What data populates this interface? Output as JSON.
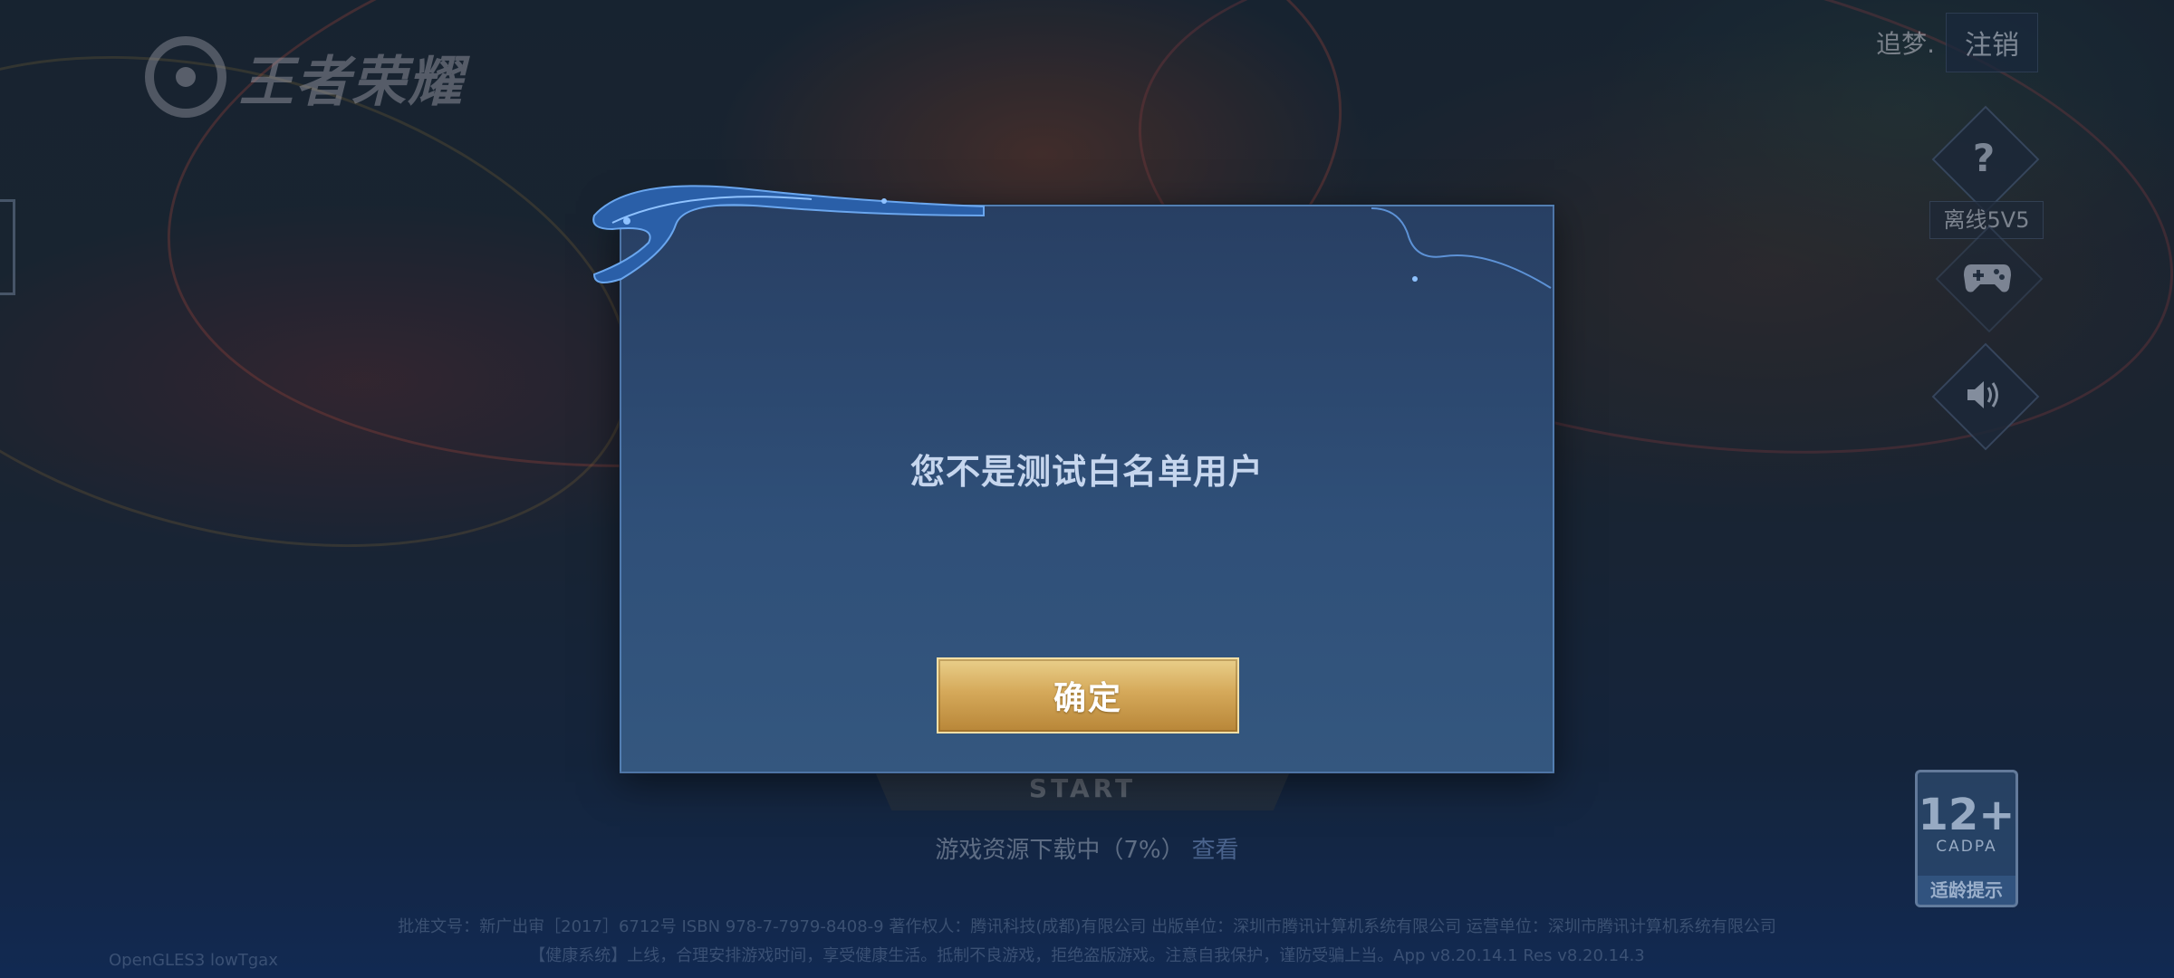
{
  "app": {
    "logo_text": "王者荣耀"
  },
  "account": {
    "name": "追梦.",
    "logout_label": "注销"
  },
  "side_buttons": {
    "help_icon": "question-icon",
    "offline_label": "离线5V5",
    "gamepad_icon": "gamepad-icon",
    "sound_icon": "speaker-icon"
  },
  "start_button": {
    "label": "START"
  },
  "download": {
    "status": "游戏资源下载中（7%）",
    "progress_percent": 7,
    "view_label": "查看"
  },
  "footer": {
    "line1": "批准文号：新广出审［2017］6712号 ISBN 978-7-7979-8408-9 著作权人：腾讯科技(成都)有限公司 出版单位：深圳市腾讯计算机系统有限公司 运营单位：深圳市腾讯计算机系统有限公司",
    "line2": "【健康系统】上线，合理安排游戏时间，享受健康生活。抵制不良游戏，拒绝盗版游戏。注意自我保护，谨防受骗上当。App v8.20.14.1 Res v8.20.14.3",
    "opengl": "OpenGLES3 lowTgax"
  },
  "age_rating": {
    "number": "12+",
    "org": "CADPA",
    "tip": "适龄提示"
  },
  "dialog": {
    "message": "您不是测试白名单用户",
    "confirm_label": "确定"
  }
}
